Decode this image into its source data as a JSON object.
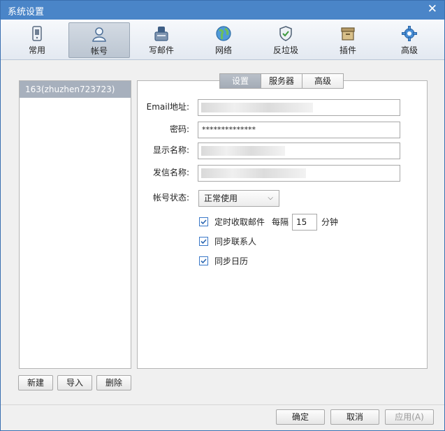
{
  "window": {
    "title": "系统设置",
    "close_glyph": "✕"
  },
  "toolbar": {
    "items": [
      {
        "label": "常用",
        "icon": "general-icon"
      },
      {
        "label": "帐号",
        "icon": "account-icon"
      },
      {
        "label": "写邮件",
        "icon": "compose-icon"
      },
      {
        "label": "网络",
        "icon": "network-icon"
      },
      {
        "label": "反垃圾",
        "icon": "antispam-shield-icon"
      },
      {
        "label": "插件",
        "icon": "plugin-box-icon"
      },
      {
        "label": "高级",
        "icon": "advanced-gear-icon"
      }
    ],
    "active": "帐号"
  },
  "accounts": {
    "items": [
      "163(zhuzhen723723)"
    ],
    "new_label": "新建",
    "import_label": "导入",
    "delete_label": "删除"
  },
  "tabs": {
    "items": [
      "设置",
      "服务器",
      "高级"
    ],
    "active": "设置"
  },
  "form": {
    "email_label": "Email地址:",
    "password_label": "密码:",
    "password_value": "**************",
    "display_name_label": "显示名称:",
    "sender_name_label": "发信名称:",
    "status_label": "帐号状态:",
    "status_value": "正常使用",
    "auto_receive_label": "定时收取邮件",
    "every_label": "每隔",
    "interval_value": "15",
    "minutes_label": "分钟",
    "sync_contacts_label": "同步联系人",
    "sync_calendar_label": "同步日历"
  },
  "footer": {
    "ok_label": "确定",
    "cancel_label": "取消",
    "apply_label": "应用(A)"
  },
  "colors": {
    "titlebar": "#4a85c8",
    "accent": "#3a78c8",
    "selected_item": "#a7b0bd"
  }
}
